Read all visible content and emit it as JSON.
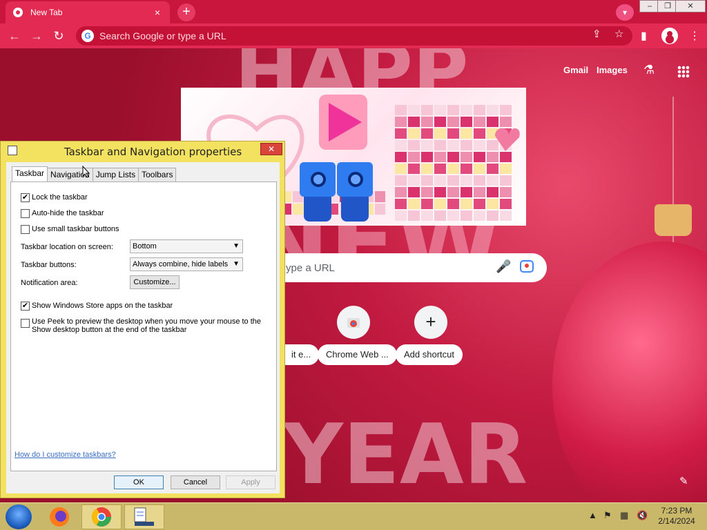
{
  "browser": {
    "tab_title": "New Tab",
    "tab_close": "×",
    "new_tab": "+",
    "omnibox_placeholder": "Search Google or type a URL",
    "window_controls": [
      "–",
      "❐",
      "✕"
    ]
  },
  "ntp": {
    "top_links": [
      "Gmail",
      "Images"
    ],
    "search_fragment": "ype a URL",
    "shortcuts": [
      {
        "label": "it e...",
        "icon": ""
      },
      {
        "label": "Chrome Web ...",
        "icon": "chrome-web-store-icon"
      },
      {
        "label": "Add shortcut",
        "icon": "plus-icon",
        "glyph": "+"
      }
    ],
    "background_text": [
      "HAPP",
      "NEW",
      "YEAR"
    ]
  },
  "dialog": {
    "title": "Taskbar and Navigation properties",
    "close": "✕",
    "tabs": [
      "Taskbar",
      "Navigation",
      "Jump Lists",
      "Toolbars"
    ],
    "active_tab": "Taskbar",
    "checkboxes": [
      {
        "label": "Lock the taskbar",
        "checked": true
      },
      {
        "label": "Auto-hide the taskbar",
        "checked": false
      },
      {
        "label": "Use small taskbar buttons",
        "checked": false
      }
    ],
    "location_label": "Taskbar location on screen:",
    "location_value": "Bottom",
    "buttons_label": "Taskbar buttons:",
    "buttons_value": "Always combine, hide labels",
    "notification_label": "Notification area:",
    "customize": "Customize...",
    "store_apps": {
      "label": "Show Windows Store apps on the taskbar",
      "checked": true
    },
    "peek": {
      "label": "Use Peek to preview the desktop when you move your mouse to the Show desktop button at the end of the taskbar",
      "checked": false
    },
    "help_link": "How do I customize taskbars?",
    "ok": "OK",
    "cancel": "Cancel",
    "apply": "Apply"
  },
  "taskbar": {
    "time": "7:23 PM",
    "date": "2/14/2024",
    "apps": [
      "start-icon",
      "firefox-icon",
      "chrome-icon",
      "taskbar-properties-icon"
    ]
  }
}
